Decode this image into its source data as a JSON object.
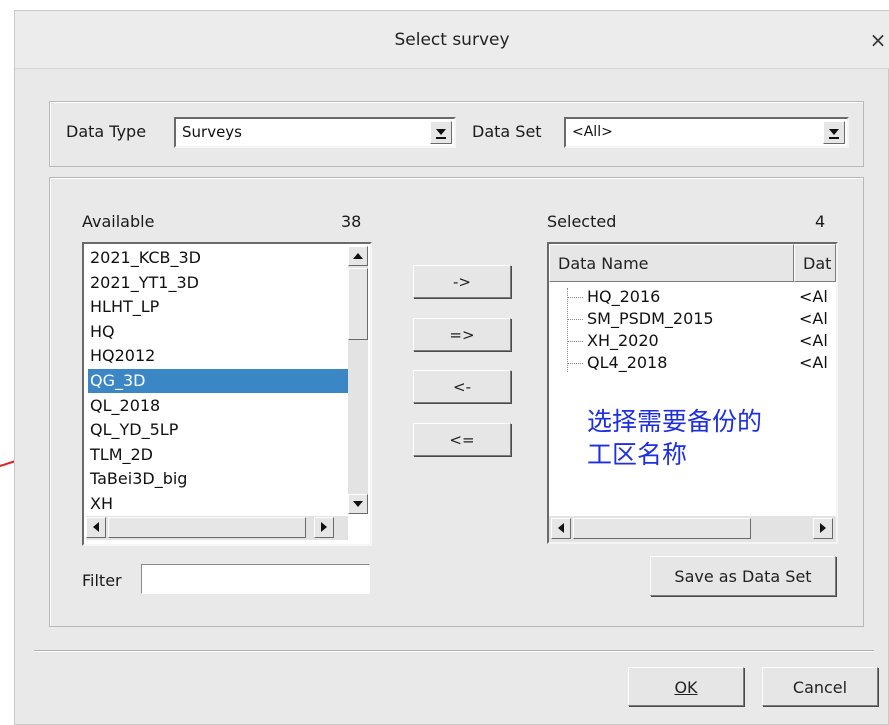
{
  "dialog": {
    "title": "Select survey",
    "close_glyph": "×"
  },
  "filters": {
    "data_type_label": "Data Type",
    "data_type_value": "Surveys",
    "data_set_label": "Data Set",
    "data_set_value": "<All>"
  },
  "available": {
    "label": "Available",
    "count": "38",
    "items": [
      "2021_KCB_3D",
      "2021_YT1_3D",
      "HLHT_LP",
      "HQ",
      "HQ2012",
      "QG_3D",
      "QL_2018",
      "QL_YD_5LP",
      "TLM_2D",
      "TaBei3D_big",
      "XH"
    ],
    "selected_index": 5,
    "filter_label": "Filter",
    "filter_value": ""
  },
  "transfer_buttons": {
    "add_one": "->",
    "add_all": "=>",
    "remove_one": "<-",
    "remove_all": "<="
  },
  "selected": {
    "label": "Selected",
    "count": "4",
    "columns": [
      "Data Name",
      "Dat"
    ],
    "rows": [
      {
        "name": "HQ_2016",
        "set": "<Al"
      },
      {
        "name": "SM_PSDM_2015",
        "set": "<Al"
      },
      {
        "name": "XH_2020",
        "set": "<Al"
      },
      {
        "name": "QL4_2018",
        "set": "<Al"
      }
    ],
    "save_label": "Save as Data Set"
  },
  "annotation": {
    "line1": "选择需要备份的",
    "line2": "工区名称",
    "arrow_color": "#e02020",
    "text_color": "#1d2fe0"
  },
  "footer": {
    "ok_label": "OK",
    "cancel_label": "Cancel"
  }
}
